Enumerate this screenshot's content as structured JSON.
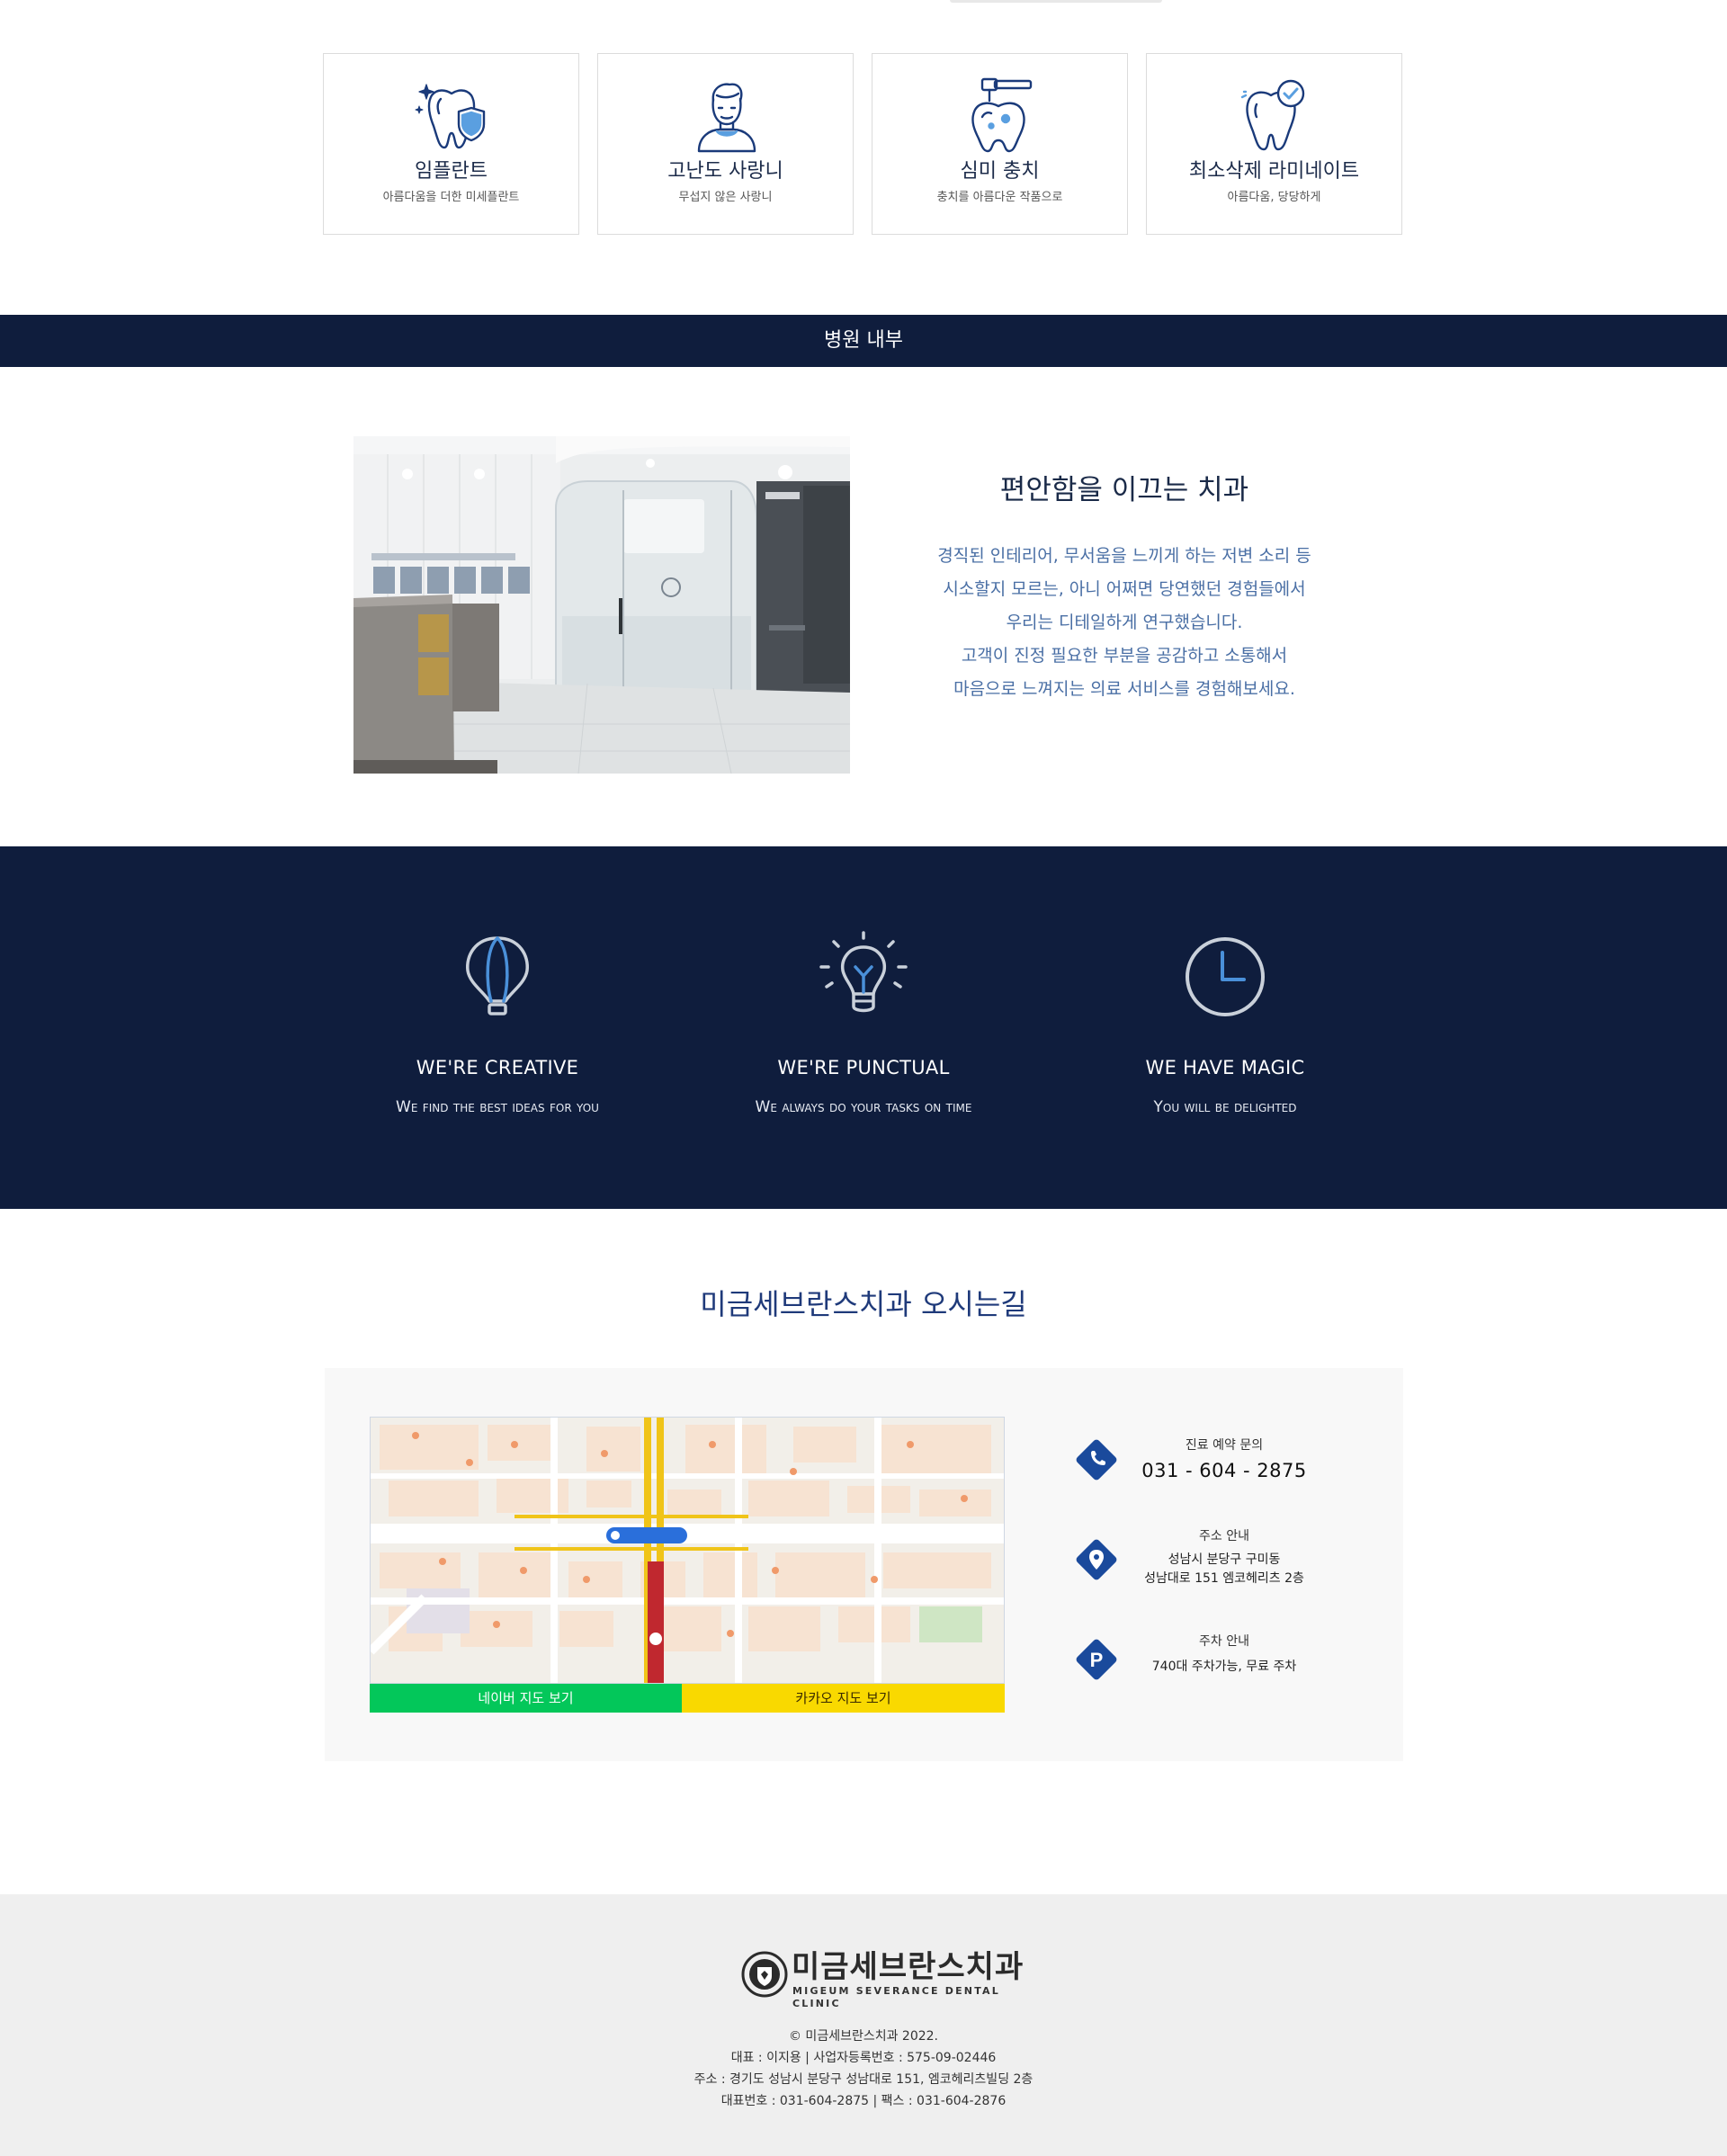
{
  "services": [
    {
      "icon": "implant-tooth-shield-icon",
      "title": "임플란트",
      "subtitle": "아름다움을 더한 미세플란트"
    },
    {
      "icon": "patient-person-icon",
      "title": "고난도 사랑니",
      "subtitle": "무섭지 않은 사랑니"
    },
    {
      "icon": "cavity-drill-tooth-icon",
      "title": "심미 충치",
      "subtitle": "충치를 아름다운 작품으로"
    },
    {
      "icon": "tooth-check-icon",
      "title": "최소삭제 라미네이트",
      "subtitle": "아름다움, 당당하게"
    }
  ],
  "interior": {
    "banner": "병원 내부",
    "heading": "편안함을 이끄는 치과",
    "lines": [
      "경직된 인테리어, 무서움을 느끼게 하는 저변 소리 등",
      "시소할지 모르는, 아니 어쩌면 당연했던 경험들에서",
      "우리는 디테일하게 연구했습니다.",
      "고객이 진정 필요한 부분을 공감하고 소통해서",
      "마음으로 느껴지는 의료 서비스를 경험해보세요."
    ]
  },
  "features": [
    {
      "icon": "hot-air-balloon-icon",
      "title": "WE'RE CREATIVE",
      "desc": "We find the best ideas for you"
    },
    {
      "icon": "lightbulb-icon",
      "title": "WE'RE PUNCTUAL",
      "desc": "We always do your tasks on time"
    },
    {
      "icon": "clock-icon",
      "title": "WE HAVE MAGIC",
      "desc": "You will be delighted"
    }
  ],
  "directions": {
    "title": "미금세브란스치과 오시는길",
    "naver_button": "네이버 지도 보기",
    "kakao_button": "카카오 지도 보기",
    "phone": {
      "label": "진료 예약 문의",
      "value": "031 - 604 - 2875"
    },
    "address": {
      "label": "주소 안내",
      "line1": "성남시 분당구 구미동",
      "line2": "성남대로 151 엠코헤리츠 2층"
    },
    "parking": {
      "label": "주차 안내",
      "value": "740대 주차가능, 무료 주차"
    }
  },
  "footer": {
    "logo_ko": "미금세브란스치과",
    "logo_en": "MIGEUM SEVERANCE DENTAL CLINIC",
    "lines": [
      "© 미금세브란스치과 2022.",
      "대표 : 이지용 | 사업자등록번호 : 575-09-02446",
      "주소 : 경기도 성남시 분당구 성남대로 151, 엠코헤리츠빌딩 2층",
      "대표번호 : 031-604-2875 | 팩스 : 031-604-2876"
    ]
  },
  "colors": {
    "navy": "#0f1d3d",
    "blue_accent": "#1a4a9c",
    "text_blue": "#4a6fa5",
    "naver_green": "#03c75a",
    "kakao_yellow": "#f9d900"
  }
}
